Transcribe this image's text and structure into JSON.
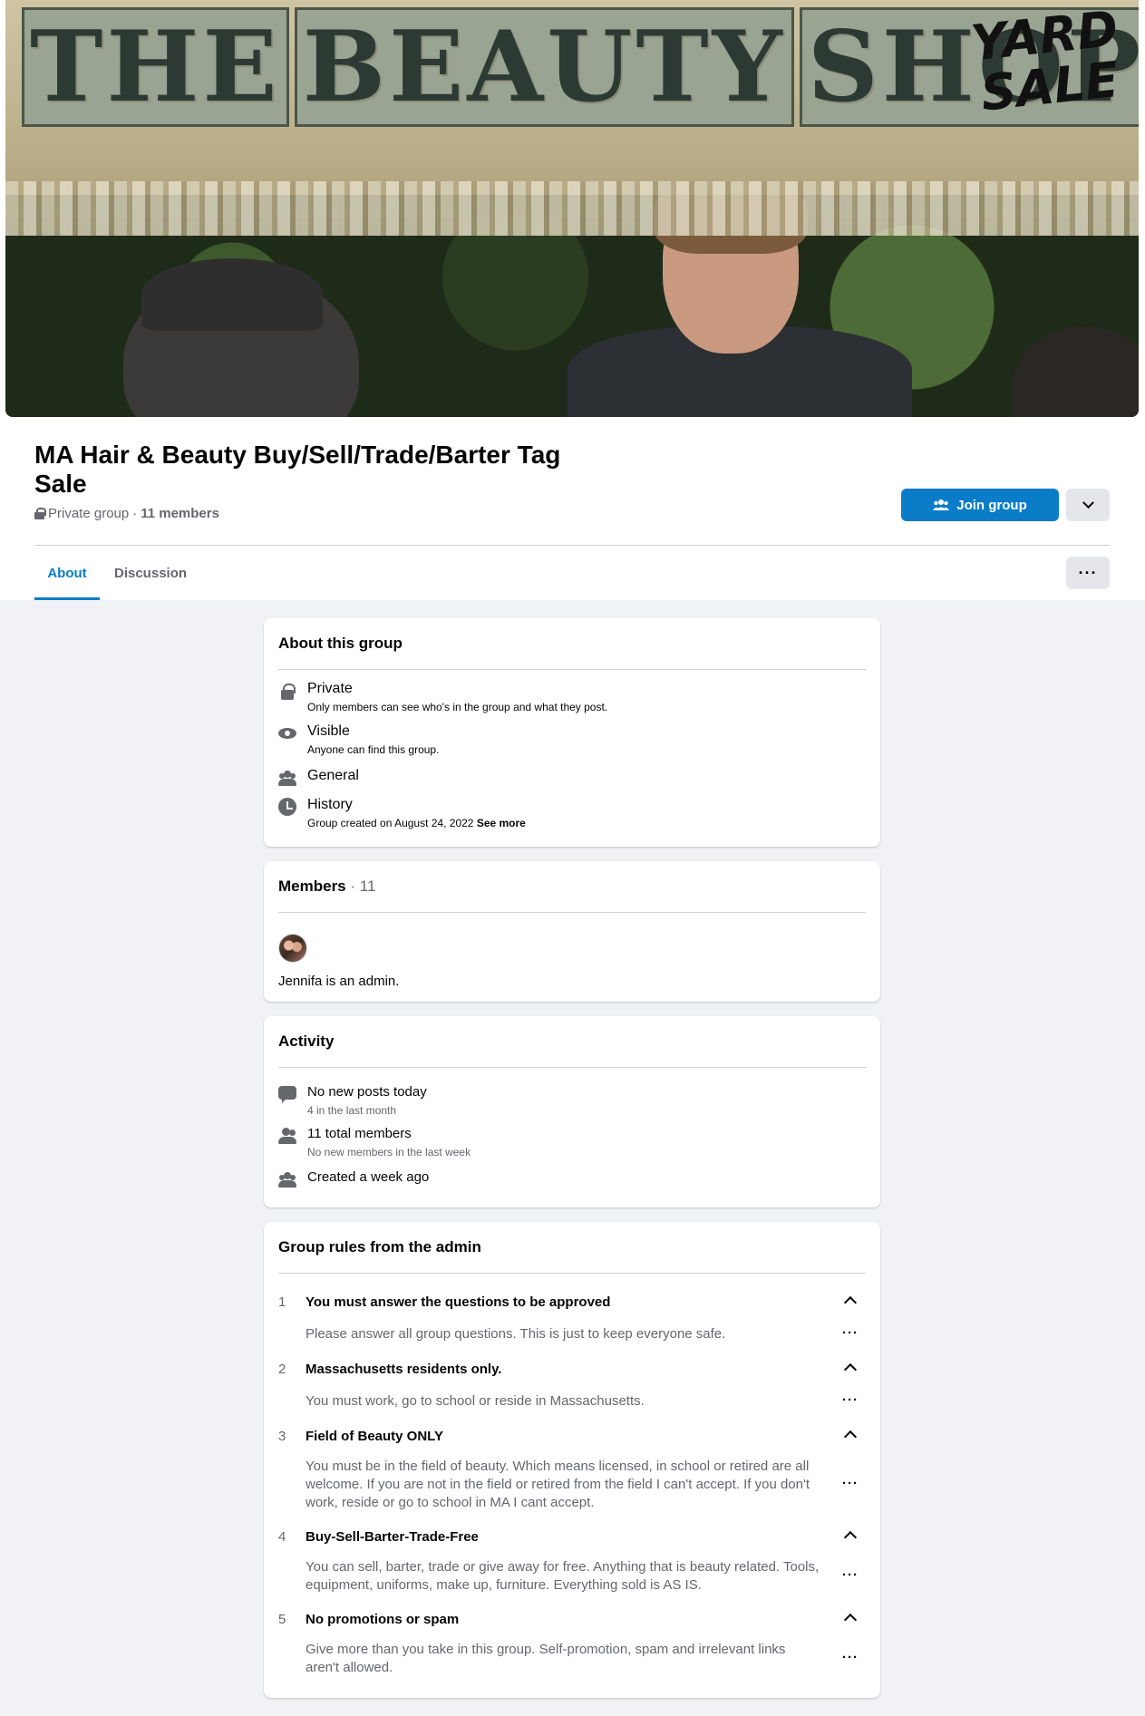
{
  "cover": {
    "words": [
      "THE",
      "BEAUTY",
      "SHOP"
    ],
    "scrawl_line1": "YARD",
    "scrawl_line2": "SALE"
  },
  "header": {
    "title": "MA Hair & Beauty Buy/Sell/Trade/Barter Tag Sale",
    "privacy": "Private group",
    "separator": "·",
    "members": "11 members",
    "join_label": "Join group"
  },
  "tabs": [
    {
      "label": "About",
      "active": true
    },
    {
      "label": "Discussion",
      "active": false
    }
  ],
  "about": {
    "title": "About this group",
    "items": [
      {
        "icon": "lock-icon",
        "label": "Private",
        "sub": "Only members can see who's in the group and what they post."
      },
      {
        "icon": "eye-icon",
        "label": "Visible",
        "sub": "Anyone can find this group."
      },
      {
        "icon": "people-icon",
        "label": "General",
        "sub": ""
      },
      {
        "icon": "clock-icon",
        "label": "History",
        "sub": "Group created on August 24, 2022",
        "see_more": "See more"
      }
    ]
  },
  "members": {
    "title": "Members",
    "count": "· 11",
    "admin_note": "Jennifa is an admin."
  },
  "activity": {
    "title": "Activity",
    "items": [
      {
        "icon": "chat-icon",
        "label": "No new posts today",
        "sub": "4 in the last month"
      },
      {
        "icon": "people-icon",
        "label": "11 total members",
        "sub": "No new members in the last week"
      },
      {
        "icon": "people-icon",
        "label": "Created a week ago",
        "sub": ""
      }
    ]
  },
  "rules": {
    "title": "Group rules from the admin",
    "items": [
      {
        "num": "1",
        "title": "You must answer the questions to be approved",
        "body": "Please answer all group questions. This is just to keep everyone safe."
      },
      {
        "num": "2",
        "title": "Massachusetts residents only.",
        "body": "You must work, go to school or reside in Massachusetts."
      },
      {
        "num": "3",
        "title": "Field of Beauty ONLY",
        "body": "You must be in the field of beauty. Which means licensed, in school or retired are all welcome. If you are not in the field or retired from the field I can't accept. If you don't work, reside or go to school in MA I cant accept."
      },
      {
        "num": "4",
        "title": "Buy-Sell-Barter-Trade-Free",
        "body": "You can sell, barter, trade or give away for free. Anything that is beauty related. Tools, equipment, uniforms, make up, furniture. Everything sold is AS IS."
      },
      {
        "num": "5",
        "title": "No promotions or spam",
        "body": "Give more than you take in this group. Self-promotion, spam and irrelevant links aren't allowed."
      }
    ]
  },
  "colors": {
    "accent": "#0a7cc8",
    "background": "#f0f2f5",
    "muted_text": "#65676b"
  }
}
